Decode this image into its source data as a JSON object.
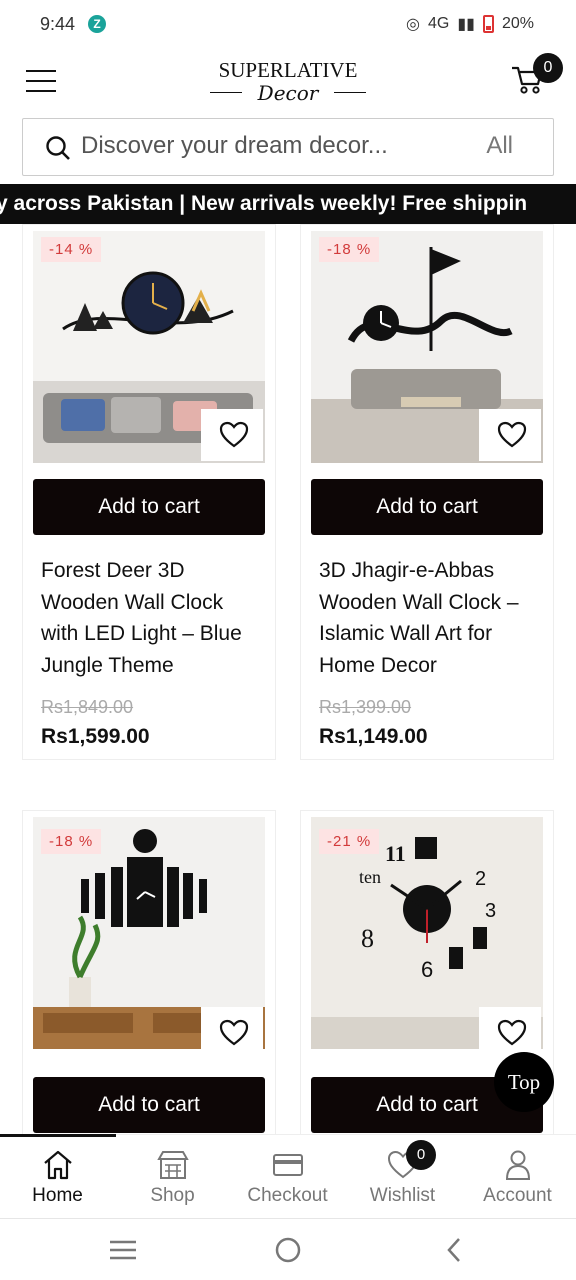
{
  "status_bar": {
    "time": "9:44",
    "network": "4G",
    "battery": "20%"
  },
  "brand": {
    "line1": "SUPERLATIVE",
    "line2": "Decor"
  },
  "cart": {
    "count": "0"
  },
  "search": {
    "placeholder": "Discover your dream decor...",
    "category": "All"
  },
  "ticker": {
    "text": "y across Pakistan | New arrivals weekly!   Free shippin"
  },
  "products": [
    {
      "discount": "-14 %",
      "button": "Add to cart",
      "title": "Forest Deer 3D Wooden Wall Clock with LED Light – Blue Jungle Theme",
      "old_price": "Rs1,849.00",
      "price": "Rs1,599.00"
    },
    {
      "discount": "-18 %",
      "button": "Add to cart",
      "title": "3D Jhagir-e-Abbas Wooden Wall Clock – Islamic Wall Art for Home Decor",
      "old_price": "Rs1,399.00",
      "price": "Rs1,149.00"
    },
    {
      "discount": "-18 %",
      "button": "Add to cart"
    },
    {
      "discount": "-21 %",
      "button": "Add to cart"
    }
  ],
  "top_button": "Top",
  "bottom_nav": {
    "items": [
      {
        "label": "Home",
        "icon": "home-icon"
      },
      {
        "label": "Shop",
        "icon": "shop-icon"
      },
      {
        "label": "Checkout",
        "icon": "card-icon"
      },
      {
        "label": "Wishlist",
        "icon": "heart-icon"
      },
      {
        "label": "Account",
        "icon": "user-icon"
      }
    ],
    "wishlist_count": "0"
  },
  "colors": {
    "accent": "#0d0606",
    "badge_bg": "#fde3e3",
    "badge_text": "#d23b3b"
  }
}
